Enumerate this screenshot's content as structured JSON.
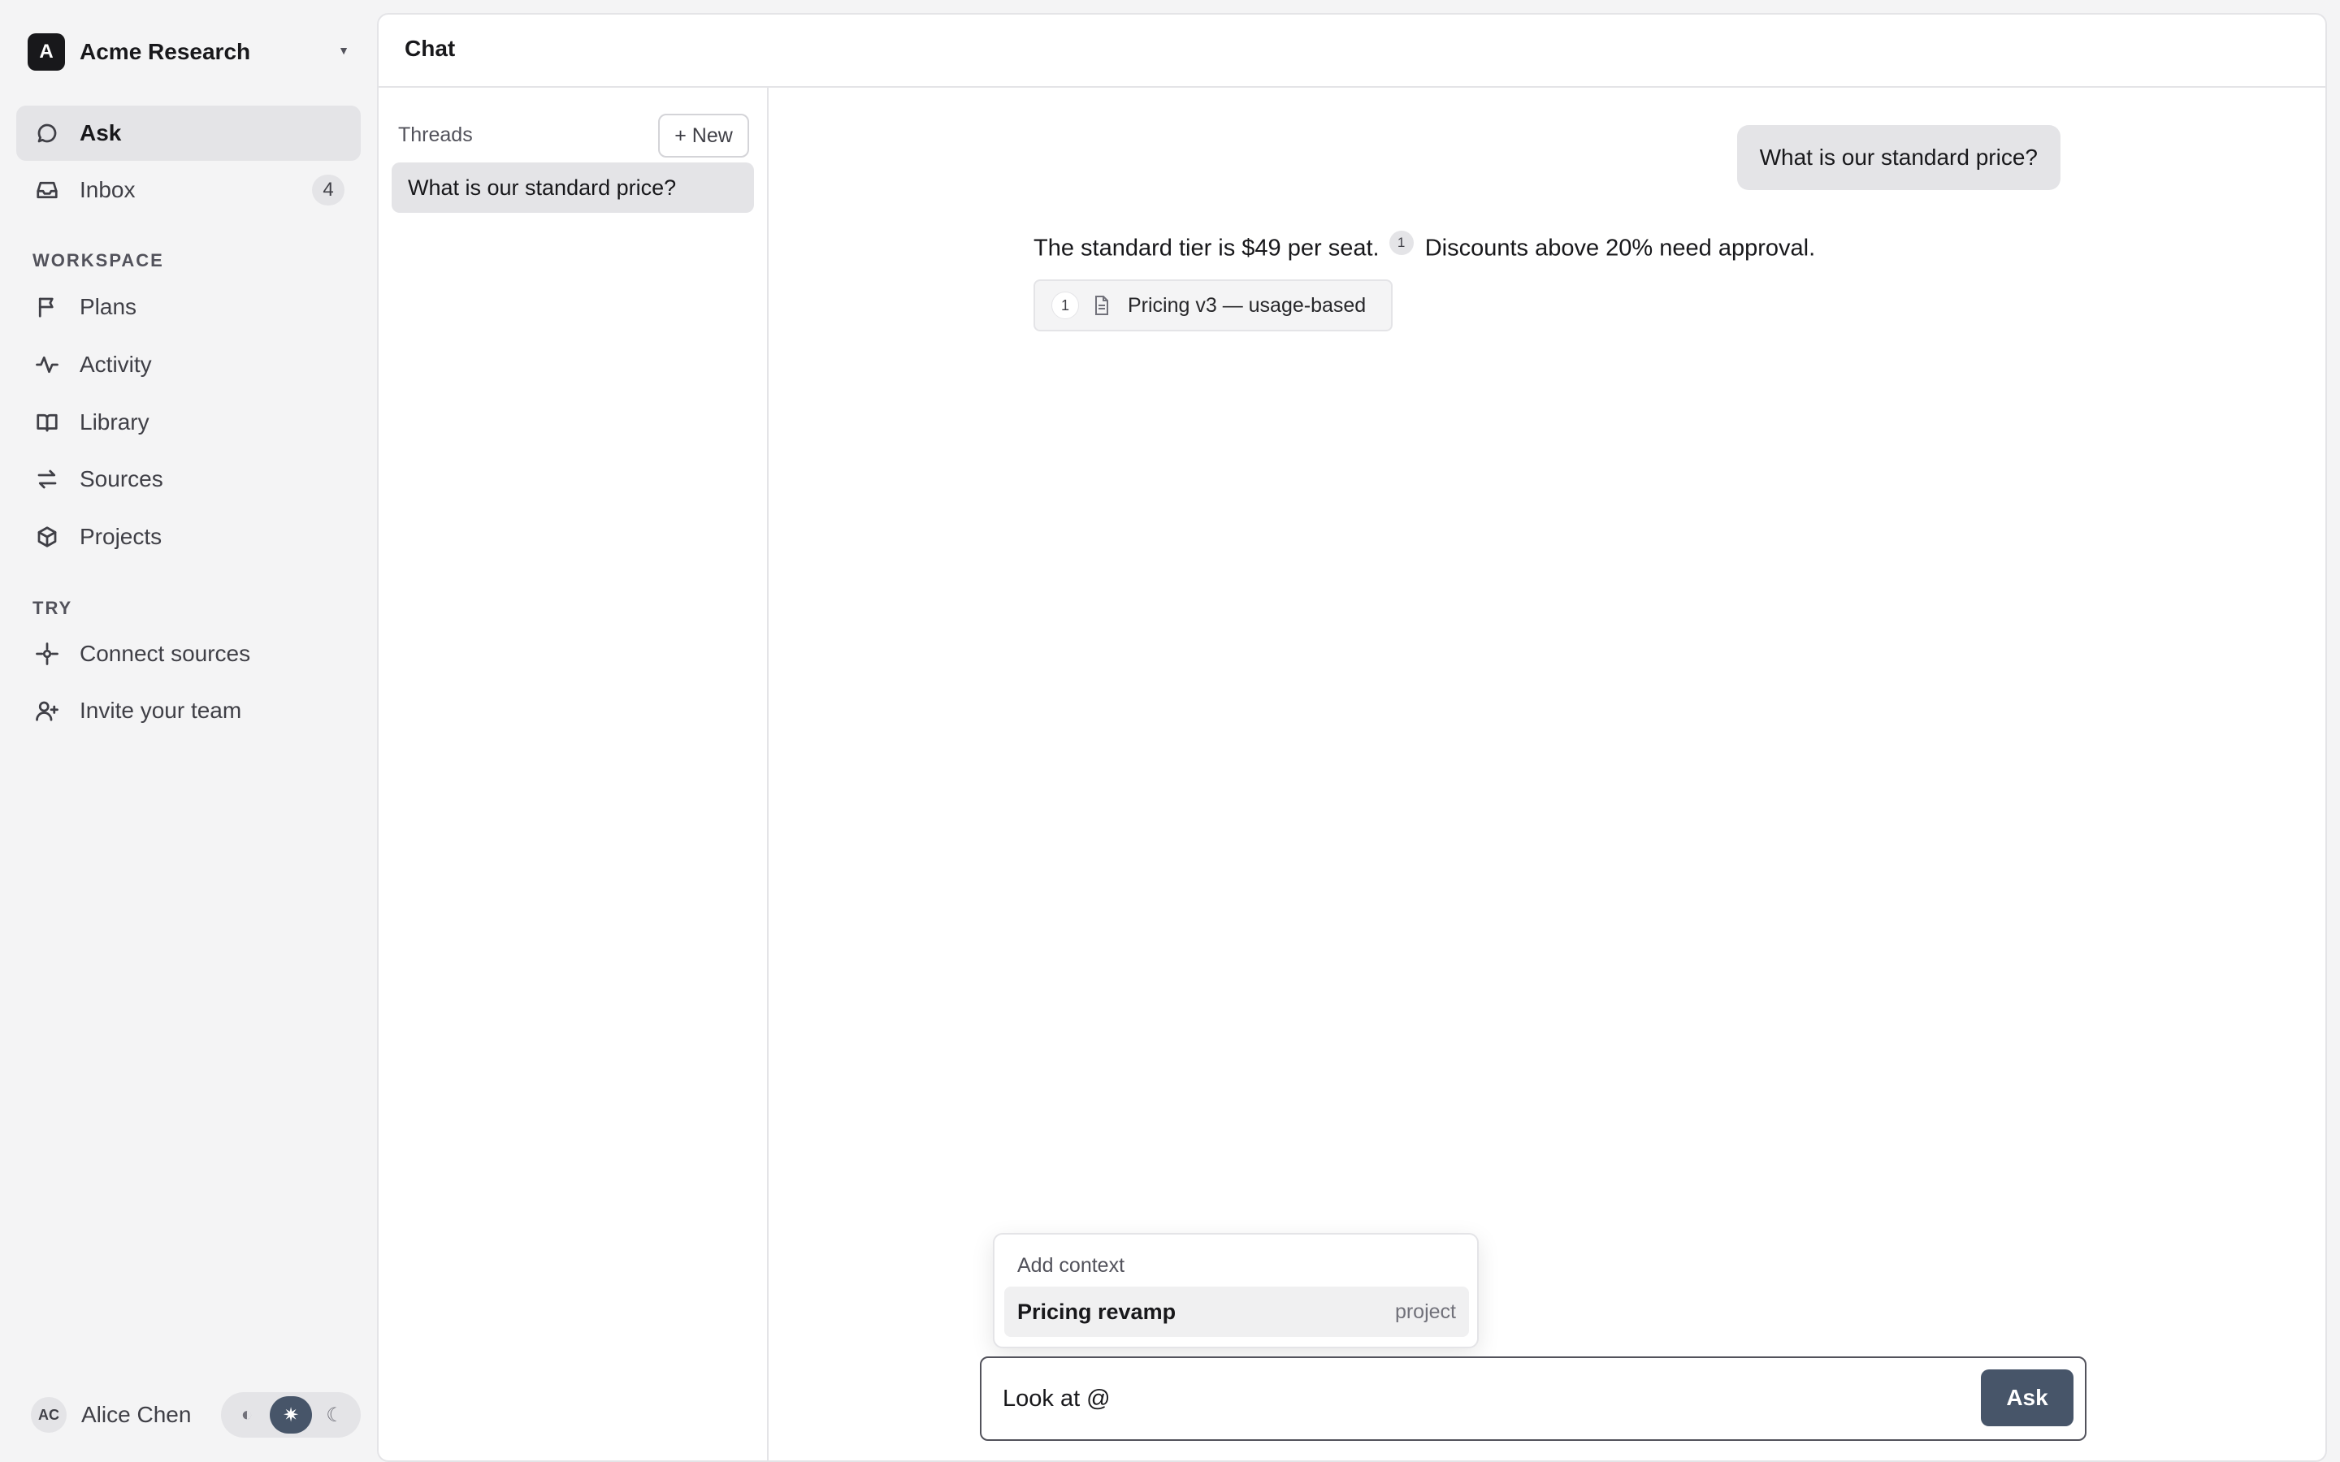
{
  "org": {
    "initial": "A",
    "name": "Acme Research"
  },
  "nav": {
    "ask": "Ask",
    "inbox": "Inbox",
    "inbox_count": "4",
    "workspace_label": "WORKSPACE",
    "plans": "Plans",
    "activity": "Activity",
    "library": "Library",
    "sources": "Sources",
    "projects": "Projects",
    "try_label": "TRY",
    "connect_sources": "Connect sources",
    "invite_team": "Invite your team"
  },
  "user": {
    "initials": "AC",
    "name": "Alice Chen"
  },
  "theme": {
    "options": [
      "auto",
      "light",
      "dark"
    ],
    "selected": "light"
  },
  "chat": {
    "title": "Chat",
    "threads_label": "Threads",
    "new_button": "+ New",
    "threads": [
      "What is our standard price?"
    ],
    "messages": {
      "user": "What is our standard price?",
      "answer_part1": "The standard tier is $49 per seat.",
      "citation": "1",
      "answer_part2": "Discounts above 20% need approval."
    },
    "source": {
      "number": "1",
      "title": "Pricing v3 — usage-based"
    }
  },
  "context_menu": {
    "title": "Add context",
    "item_name": "Pricing revamp",
    "item_kind": "project"
  },
  "composer": {
    "value": "Look at @",
    "ask_button": "Ask"
  },
  "colors": {
    "accent": "#475569",
    "active_bg": "#e4e4e7",
    "background": "#f4f4f5"
  }
}
